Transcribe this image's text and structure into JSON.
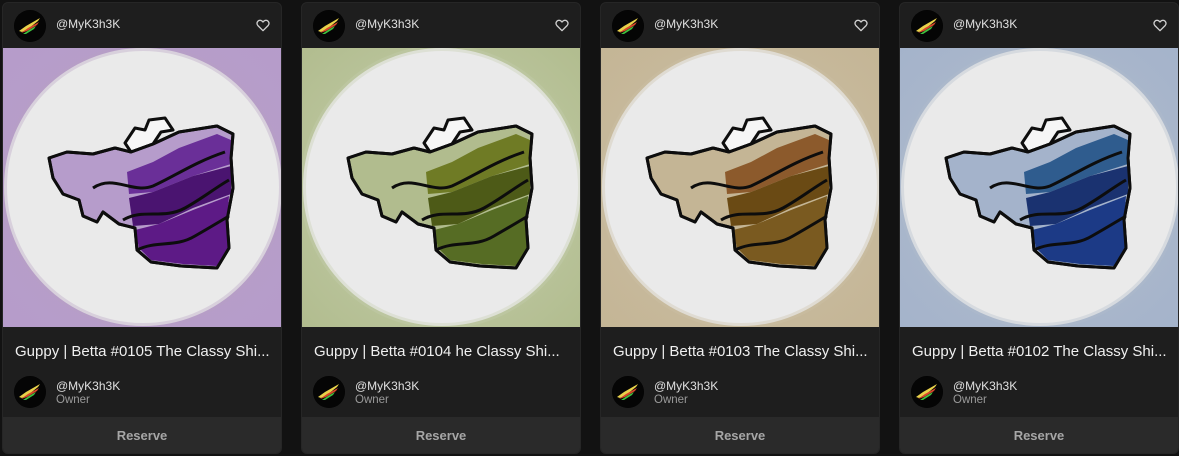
{
  "cards": [
    {
      "handle": "@MyK3h3K",
      "title": "Guppy | Betta #0105 The Classy Shi...",
      "owner": "@MyK3h3K",
      "owner_role": "Owner",
      "reserve_label": "Reserve",
      "colors": {
        "ring": "#b8a0c4",
        "light": "#b69ccb",
        "mid": "#6a2f98",
        "dark": "#4a1470",
        "tail": "#5d1a86"
      }
    },
    {
      "handle": "@MyK3h3K",
      "title": "Guppy | Betta #0104 he Classy Shi...",
      "owner": "@MyK3h3K",
      "owner_role": "Owner",
      "reserve_label": "Reserve",
      "colors": {
        "ring": "#c6cfae",
        "light": "#b1bc8e",
        "mid": "#6f7b25",
        "dark": "#4d5a17",
        "tail": "#566c24"
      }
    },
    {
      "handle": "@MyK3h3K",
      "title": "Guppy | Betta #0103 The Classy Shi...",
      "owner": "@MyK3h3K",
      "owner_role": "Owner",
      "reserve_label": "Reserve",
      "colors": {
        "ring": "#cbbfa6",
        "light": "#c4b595",
        "mid": "#8c5a2c",
        "dark": "#6a4a14",
        "tail": "#7a5a20"
      }
    },
    {
      "handle": "@MyK3h3K",
      "title": "Guppy | Betta #0102 The Classy Shi...",
      "owner": "@MyK3h3K",
      "owner_role": "Owner",
      "reserve_label": "Reserve",
      "colors": {
        "ring": "#b2bccb",
        "light": "#a4b3cb",
        "mid": "#2f5c8e",
        "dark": "#1a3270",
        "tail": "#1c3a86"
      }
    }
  ]
}
